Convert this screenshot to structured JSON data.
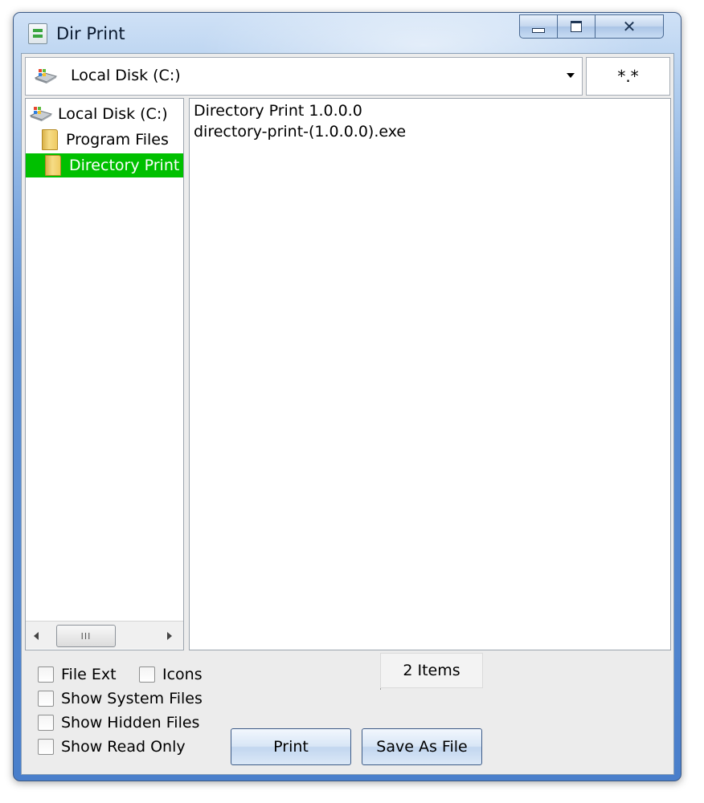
{
  "window": {
    "title": "Dir Print"
  },
  "toolbar": {
    "drive_label": "Local Disk (C:)",
    "filter": "*.*"
  },
  "tree": {
    "items": [
      {
        "label": "Local Disk (C:)",
        "icon": "drive-icon",
        "selected": false
      },
      {
        "label": "Program Files",
        "icon": "folder-icon",
        "selected": false
      },
      {
        "label": "Directory Print",
        "icon": "folder-icon",
        "selected": true
      }
    ],
    "scroll_thumb_grip": "III"
  },
  "file_list": {
    "items": [
      "Directory Print 1.0.0.0",
      "directory-print-(1.0.0.0).exe"
    ]
  },
  "options": {
    "file_ext": "File Ext",
    "icons": "Icons",
    "show_system_files": "Show System Files",
    "show_hidden_files": "Show Hidden Files",
    "show_read_only": "Show Read Only"
  },
  "status": {
    "items_count": "2 Items"
  },
  "buttons": {
    "print": "Print",
    "save_as_file": "Save As File"
  },
  "colors": {
    "selection": "#00c000",
    "title_bar": "#a9c8ec",
    "frame": "#4a7fcb"
  }
}
